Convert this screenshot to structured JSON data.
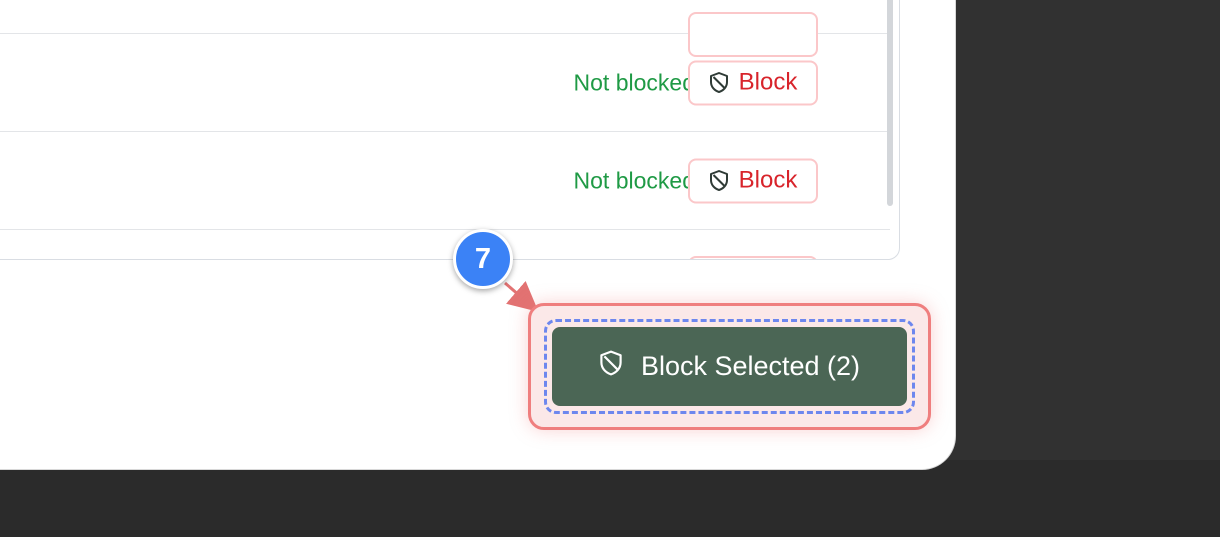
{
  "rows": [
    {
      "status": "Not blocked",
      "action_label": "Block"
    },
    {
      "status": "Not blocked",
      "action_label": "Block"
    }
  ],
  "footer": {
    "block_selected_label": "Block Selected (2)"
  },
  "annotation": {
    "step_number": "7"
  },
  "colors": {
    "status_ok": "#1f9a45",
    "danger": "#d8242b",
    "primary_button": "#4b6655",
    "annotation_badge": "#3b82f6",
    "highlight": "#ef7e7e",
    "focus_ring": "#6d87ee"
  },
  "icons": {
    "block_button": "shield-icon",
    "block_selected_button": "shield-icon"
  }
}
